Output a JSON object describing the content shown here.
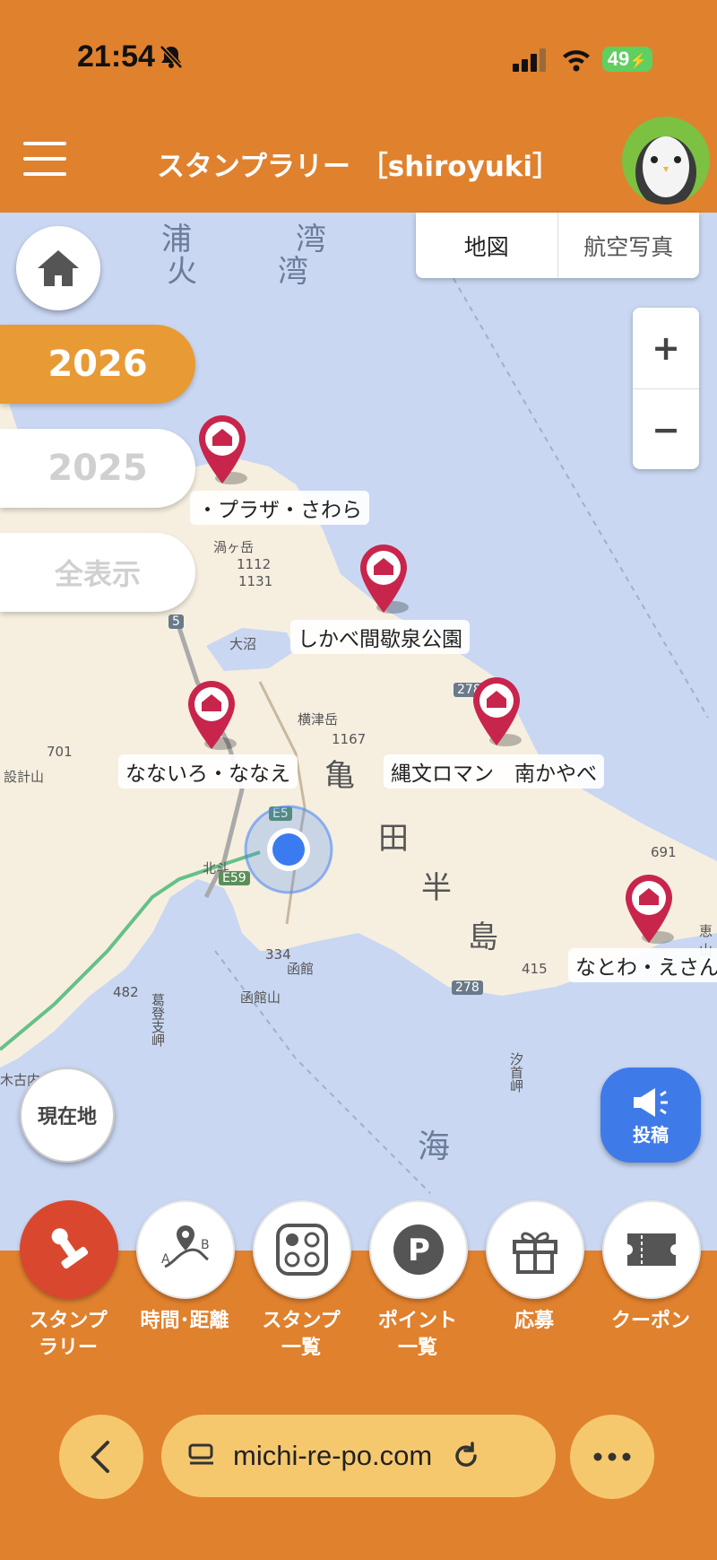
{
  "status_bar": {
    "time": "21:54",
    "battery": "49"
  },
  "header": {
    "title": "スタンプラリー ［shiroyuki］"
  },
  "map": {
    "type_toggle": {
      "map_label": "地図",
      "aerial_label": "航空写真"
    },
    "zoom": {
      "in_label": "+",
      "out_label": "−"
    },
    "years": [
      {
        "label": "2026",
        "active": true
      },
      {
        "label": "2025",
        "active": false
      },
      {
        "label": "全表示",
        "active": false
      }
    ],
    "locate_label": "現在地",
    "post_label": "投稿",
    "place_labels": [
      "・プラザ・さわら",
      "しかべ間歇泉公園",
      "なないろ・ななえ",
      "縄文ロマン　南かやべ",
      "なとわ・えさん"
    ],
    "map_text": {
      "bay": [
        "浦",
        "湾",
        "火",
        "湾"
      ],
      "peninsula": [
        "亀",
        "田",
        "半",
        "島"
      ],
      "sea": "海",
      "mt_kamagatake": "渦ヶ岳",
      "mt_yokotsu": "横津岳",
      "onuma": "大沼",
      "hakodate": "函館",
      "hakodateyama": "函館山",
      "hokuto": "北斗",
      "elev": [
        "1112",
        "1131",
        "1167",
        "701",
        "691",
        "415",
        "334",
        "482"
      ],
      "roads": [
        "E5",
        "E59",
        "5",
        "278",
        "278"
      ],
      "misc": [
        "設計山",
        "汐首岬",
        "恵山",
        "葛登支岬",
        "木古内"
      ]
    }
  },
  "bottom_nav": [
    {
      "label": "スタンプ\nラリー",
      "icon": "stamp-icon",
      "active": true
    },
    {
      "label": "時間･距離",
      "icon": "route-icon",
      "active": false
    },
    {
      "label": "スタンプ\n一覧",
      "icon": "grid-icon",
      "active": false
    },
    {
      "label": "ポイント\n一覧",
      "icon": "points-icon",
      "active": false
    },
    {
      "label": "応募",
      "icon": "gift-icon",
      "active": false
    },
    {
      "label": "クーポン",
      "icon": "ticket-icon",
      "active": false
    }
  ],
  "browser": {
    "url": "michi-re-po.com"
  }
}
